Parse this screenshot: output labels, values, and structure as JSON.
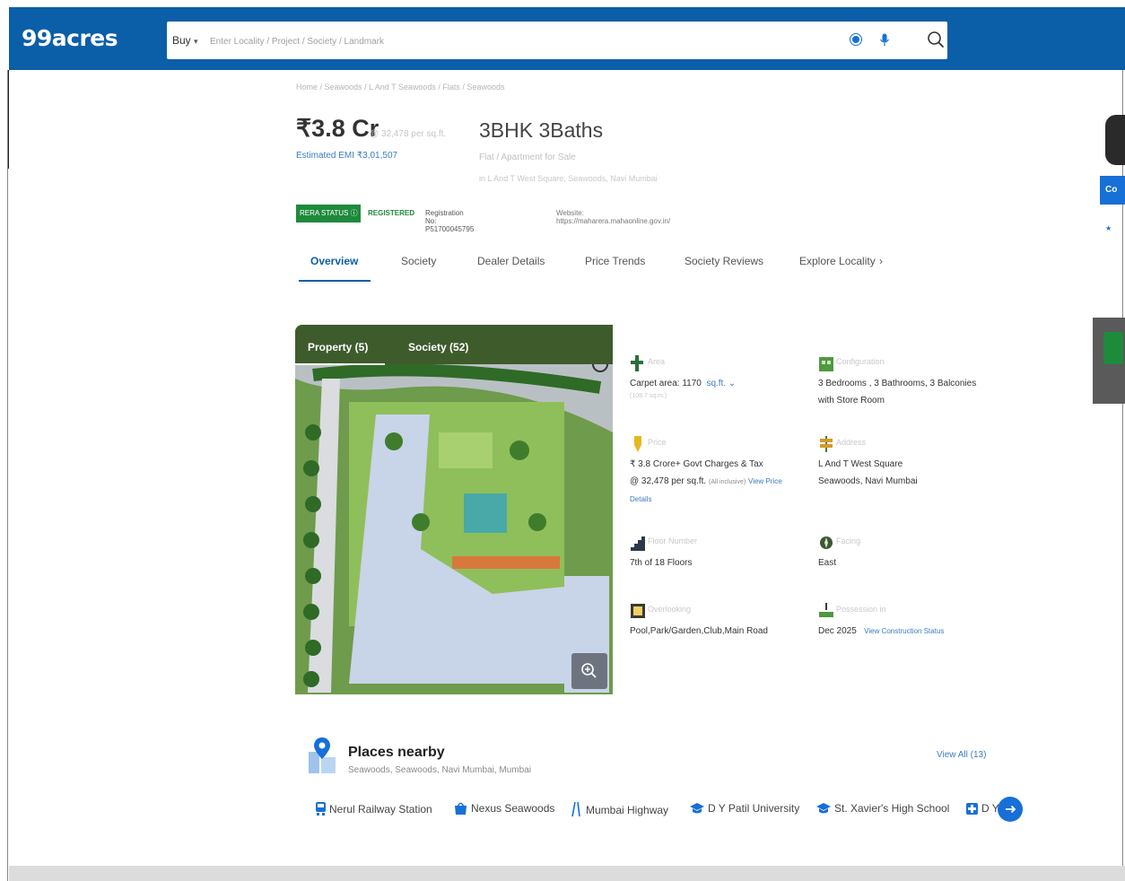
{
  "header": {
    "logo": "99acres",
    "search_mode": "Buy",
    "search_placeholder": "Enter Locality / Project / Society / Landmark"
  },
  "listing": {
    "breadcrumb": "Home / Seawoods / L And T Seawoods / Flats / Seawoods",
    "price": "₹3.8 Cr",
    "price_sub": "@ 32,478 per sq.ft.",
    "emi": "Estimated EMI ₹3,01,507",
    "title": "3BHK 3Baths",
    "type": "Flat / Apartment for Sale",
    "address_line": "in L And T West Square, Seawoods, Navi Mumbai"
  },
  "rera": {
    "badge": "RERA STATUS",
    "status": "REGISTERED",
    "registration": "Registration No: P51700045795",
    "website": "Website: https://maharera.mahaonline.gov.in/"
  },
  "tabs": [
    "Overview",
    "Society",
    "Dealer Details",
    "Price Trends",
    "Society Reviews",
    "Explore Locality"
  ],
  "gallery": {
    "tab_property": "Property (5)",
    "tab_society": "Society (52)"
  },
  "details": {
    "area_label": "Area",
    "area_value": "Carpet area: 1170",
    "area_unit": "sq.ft.",
    "area_sub": "(108.7 sq.m.)",
    "config_label": "Configuration",
    "config_value_1": "3 Bedrooms , 3 Bathrooms, 3 Balconies",
    "config_value_2": "with Store Room",
    "price_label": "Price",
    "price_value_1": "₹ 3.8 Crore+ Govt Charges & Tax",
    "price_value_2": "@ 32,478 per sq.ft.",
    "price_incl": "(All inclusive)",
    "price_link": "View Price",
    "price_link_2": "Details",
    "address_label": "Address",
    "address_value_1": "L And T West Square",
    "address_value_2": "Seawoods, Navi Mumbai",
    "floor_label": "Floor Number",
    "floor_value": "7th of 18 Floors",
    "facing_label": "Facing",
    "facing_value": "East",
    "overlooking_label": "Overlooking",
    "overlooking_value": "Pool,Park/Garden,Club,Main Road",
    "possession_label": "Possession in",
    "possession_value": "Dec 2025",
    "possession_link": "View Construction Status"
  },
  "places": {
    "title": "Places nearby",
    "subtitle": "Seawoods, Seawoods, Navi Mumbai, Mumbai",
    "view_all": "View All (13)",
    "items": [
      "Nerul Railway Station",
      "Nexus Seawoods",
      "Mumbai Highway",
      "D Y Patil University",
      "St. Xavier's High School",
      "D Y"
    ]
  },
  "side": {
    "contact": "Co"
  },
  "colors": {
    "brand": "#0b5ea8",
    "rera_green": "#1e8a3c",
    "link": "#3b7bbf",
    "accent_button": "#1670d8"
  }
}
